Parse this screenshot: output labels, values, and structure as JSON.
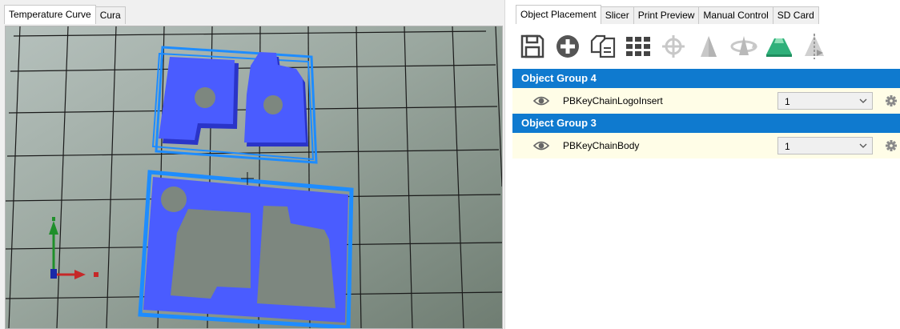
{
  "left_tabs": [
    {
      "label": "Temperature Curve",
      "active": true
    },
    {
      "label": "Cura",
      "active": false
    }
  ],
  "right_tabs": [
    {
      "label": "Object Placement",
      "active": true
    },
    {
      "label": "Slicer",
      "active": false
    },
    {
      "label": "Print Preview",
      "active": false
    },
    {
      "label": "Manual Control",
      "active": false
    },
    {
      "label": "SD Card",
      "active": false
    }
  ],
  "toolbar": {
    "icons": [
      "save-icon",
      "add-object-icon",
      "copy-object-icon",
      "grid-arrange-icon",
      "center-object-icon",
      "drop-to-bed-icon",
      "rotate-icon",
      "scale-icon",
      "mirror-icon"
    ]
  },
  "object_groups": [
    {
      "title": "Object Group 4",
      "objects": [
        {
          "name": "PBKeyChainLogoInsert",
          "count": "1"
        }
      ]
    },
    {
      "title": "Object Group 3",
      "objects": [
        {
          "name": "PBKeyChainBody",
          "count": "1"
        }
      ]
    }
  ],
  "colors": {
    "group_header": "#0f7acf",
    "object_row": "#fffde7",
    "model_fill": "#4a5cff",
    "selection_outline": "#1e8cff",
    "bed_grid": "#1a1a1a"
  }
}
